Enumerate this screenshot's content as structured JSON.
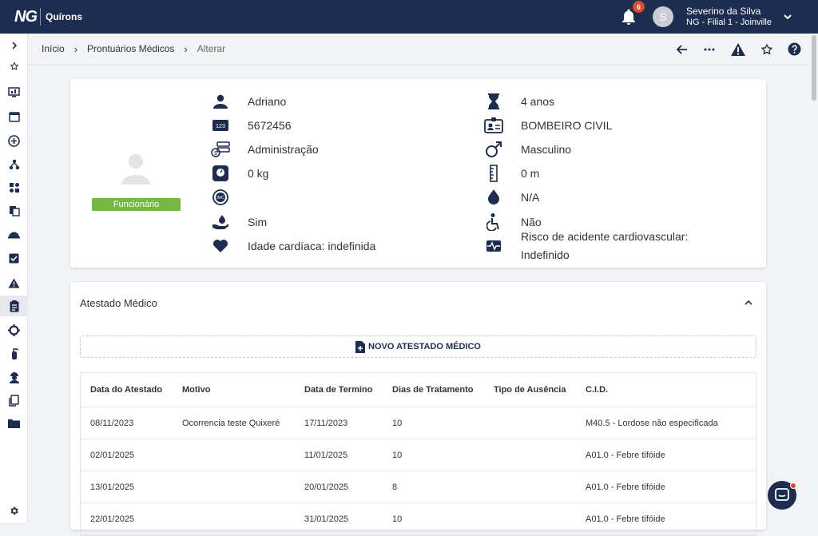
{
  "header": {
    "logo_ng": "NG",
    "logo_product": "Quírons",
    "notification_count": "6",
    "avatar_initial": "S",
    "user_name": "Severino da Silva",
    "user_branch": "NG - Filial 1 - Joinville"
  },
  "breadcrumb": {
    "home": "Início",
    "section": "Prontuários Médicos",
    "current": "Alterar"
  },
  "patient": {
    "badge": "Funcionário",
    "left": [
      {
        "icon": "person-icon",
        "value": "Adriano"
      },
      {
        "icon": "id-number-icon",
        "value": "5672456"
      },
      {
        "icon": "department-icon",
        "value": "Administração"
      },
      {
        "icon": "weight-scale-icon",
        "value": "0 kg"
      },
      {
        "icon": "imc-icon",
        "value": ""
      },
      {
        "icon": "blood-donation-icon",
        "value": "Sim"
      },
      {
        "icon": "heart-icon",
        "value": "Idade cardíaca: indefinida"
      }
    ],
    "right": [
      {
        "icon": "hourglass-icon",
        "value": "4 anos"
      },
      {
        "icon": "id-card-icon",
        "value": "BOMBEIRO CIVIL"
      },
      {
        "icon": "male-icon",
        "value": "Masculino"
      },
      {
        "icon": "ruler-icon",
        "value": "0 m"
      },
      {
        "icon": "blood-drop-icon",
        "value": "N/A"
      },
      {
        "icon": "accessibility-icon",
        "value": "Não"
      },
      {
        "icon": "cardio-monitor-icon",
        "value": "Risco de acidente cardiovascular:",
        "value2": "Indefinido"
      }
    ]
  },
  "atestado": {
    "title": "Atestado Médico",
    "new_button": "NOVO ATESTADO MÉDICO",
    "columns": [
      "Data do Atestado",
      "Motivo",
      "Data de Termino",
      "Dias de Tratamento",
      "Tipo de Ausência",
      "C.I.D."
    ],
    "rows": [
      [
        "08/11/2023",
        "Ocorrencia teste Quixeré",
        "17/11/2023",
        "10",
        "",
        "M40.5 - Lordose não especificada"
      ],
      [
        "02/01/2025",
        "",
        "11/01/2025",
        "10",
        "",
        "A01.0 - Febre tifóide"
      ],
      [
        "13/01/2025",
        "",
        "20/01/2025",
        "8",
        "",
        "A01.0 - Febre tifóide"
      ],
      [
        "22/01/2025",
        "",
        "31/01/2025",
        "10",
        "",
        "A01.0 - Febre tifóide"
      ]
    ]
  },
  "colors": {
    "navy": "#1d2d4f",
    "badge_green": "#76b846",
    "notification_red": "#e04a2a"
  }
}
